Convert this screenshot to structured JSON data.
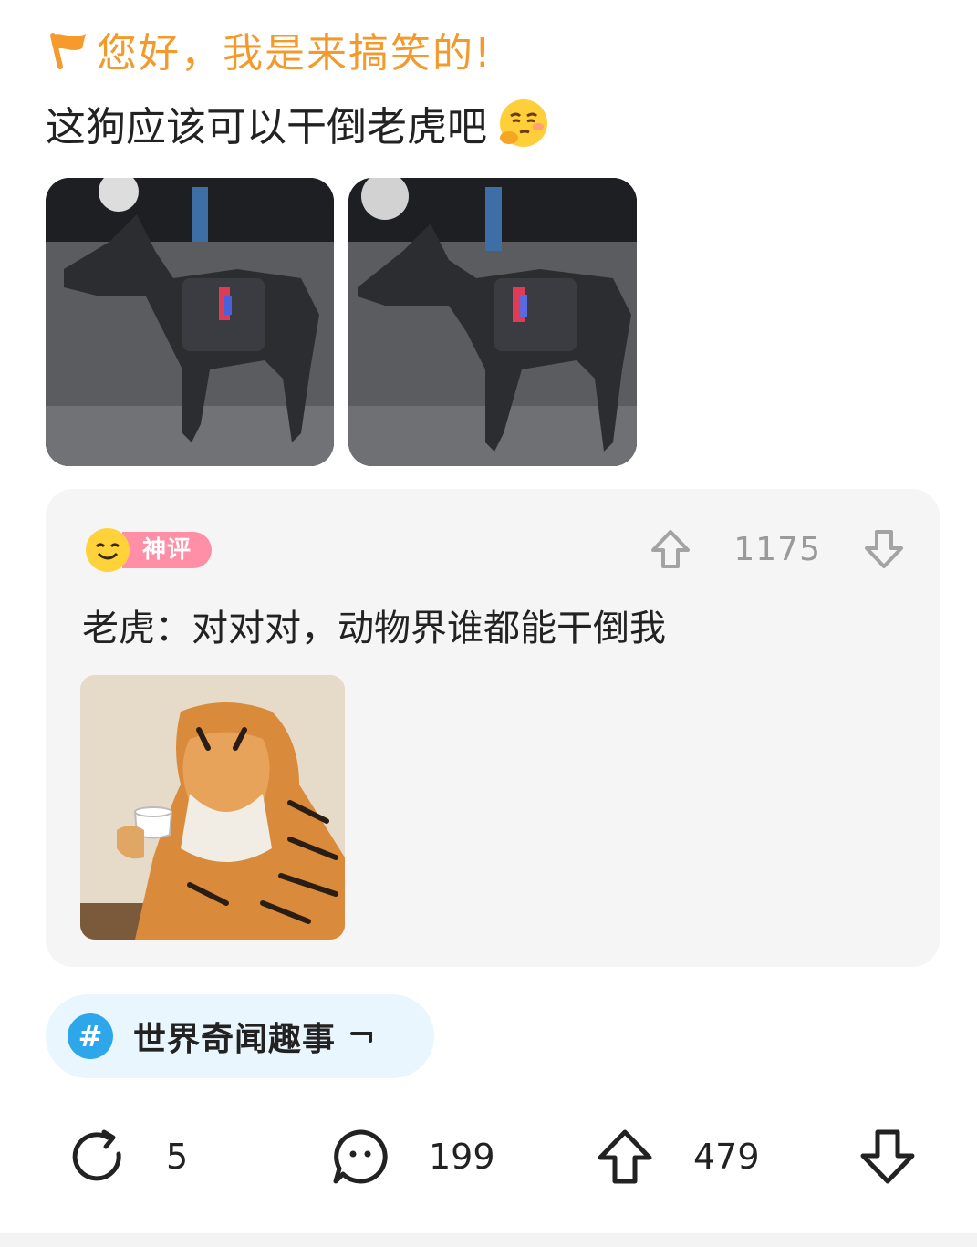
{
  "post": {
    "author": "您好，我是来搞笑的!",
    "text": "这狗应该可以干倒老虎吧",
    "author_color": "#f39a2b"
  },
  "images": [
    "dog-photo",
    "dog-photo"
  ],
  "top_comment": {
    "badge": "神评",
    "text": "老虎：对对对，动物界谁都能干倒我",
    "votes": "1175",
    "image": "tiger-holding-teacup"
  },
  "topic": {
    "label": "世界奇闻趣事",
    "icon": "#"
  },
  "actions": {
    "share_count": "5",
    "comment_count": "199",
    "upvote_count": "479"
  }
}
